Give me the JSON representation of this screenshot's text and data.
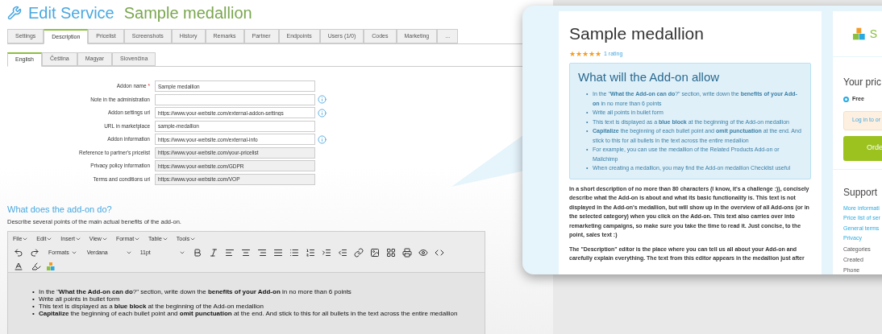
{
  "header": {
    "title": "Edit Service",
    "subtitle": "Sample medallion"
  },
  "tabs": [
    {
      "label": "Settings",
      "selected": false
    },
    {
      "label": "Description",
      "selected": true
    },
    {
      "label": "Pricelist",
      "selected": false
    },
    {
      "label": "Screenshots",
      "selected": false
    },
    {
      "label": "History",
      "selected": false
    },
    {
      "label": "Remarks",
      "selected": false
    },
    {
      "label": "Partner",
      "selected": false
    },
    {
      "label": "Endpoints",
      "selected": false
    },
    {
      "label": "Users (1/0)",
      "selected": false
    },
    {
      "label": "Codes",
      "selected": false
    },
    {
      "label": "Marketing",
      "selected": false
    },
    {
      "label": "...",
      "selected": false
    }
  ],
  "language_tabs": [
    {
      "label": "English",
      "selected": true
    },
    {
      "label": "Čeština",
      "selected": false
    },
    {
      "label": "Magyar",
      "selected": false
    },
    {
      "label": "Slovenčina",
      "selected": false
    }
  ],
  "form": [
    {
      "label": "Addon name",
      "required": true,
      "value": "Sample medallion",
      "info": false,
      "disabled": false
    },
    {
      "label": "Note in the administration",
      "required": false,
      "info": true,
      "disabled": false
    },
    {
      "label": "Addon settings url",
      "required": false,
      "value": "https://www.your-website.com/external-addon-settings",
      "info": true,
      "disabled": false
    },
    {
      "label": "URL in marketplace",
      "required": false,
      "value": "sample-medallion",
      "info": false,
      "disabled": false
    },
    {
      "label": "Addon information",
      "required": false,
      "value": "https://www.your-website.com/external-info",
      "info": true,
      "disabled": false
    },
    {
      "label": "Reference to partner's pricelist",
      "required": false,
      "value": "https://www.your-website.com/your-pricelist",
      "info": false,
      "disabled": true
    },
    {
      "label": "Privacy policy information",
      "required": false,
      "value": "https://www.your-website.com/GDPR",
      "info": false,
      "disabled": true
    },
    {
      "label": "Terms and conditions url",
      "required": false,
      "value": "https://www.your-website.com/VOP",
      "info": false,
      "disabled": true
    }
  ],
  "required_mark": "*",
  "bullet_marker": "•",
  "section": {
    "title": "What does the add-on do?",
    "description": "Describe several points of the main actual benefits of the add-on."
  },
  "editor": {
    "menus": [
      "File",
      "Edit",
      "Insert",
      "View",
      "Format",
      "Table",
      "Tools"
    ],
    "formats": "Formats",
    "font": "Verdana",
    "size": "11pt",
    "bullets": [
      "In the \"**What the Add-on can do**?\" section, write down the **benefits of your Add-on** in no more than 6 points",
      "Write all points in bullet form",
      "This text is displayed as a **blue block** at the beginning of the Add-on medallion",
      "**Capitalize** the beginning of each bullet point and **omit punctuation** at the end. And stick to this for all bullets in the text across the entire medallion"
    ]
  },
  "preview": {
    "title": "Sample medallion",
    "stars": 5,
    "rating": "1 rating",
    "box_title": "What will the Add-on allow",
    "box_bullets": [
      "In the \"**What the Add-on can do**?\" section, write down the **benefits of your Add-on** in no more than 6 points",
      "Write all points in bullet form",
      "This text is displayed as a **blue block** at the beginning of the Add-on medallion",
      "**Capitalize** the beginning of each bullet point and **omit punctuation** at the end. And stick to this for all bullets in the text across the entire medallion",
      "For example, you can use the medallion of the Related Products Add-on or Mailchimp",
      "When creating a medallion, you may find the Add-on medallion Checklist useful"
    ],
    "paragraphs": [
      "In a short description of no more than 80 characters (I know, it's a challenge :)), concisely describe what the Add-on is about and what its basic functionality is. This text is not displayed in the Add-on's medallion, but will show up in the overview of all Add-ons (or in the selected category) when you click on the Add-on. This text also carries over into remarketing campaigns, so make sure you take the time to read it. Just concise, to the point, sales text :)",
      "The \"Description\" editor is the place where you can tell us all about your Add-on and carefully explain everything. The text from this editor appears in the medallion just after"
    ]
  },
  "sidebar": {
    "logo_text": "S",
    "price_title": "Your pric",
    "price_options": [
      {
        "label": "Free",
        "selected": true
      }
    ],
    "login": "Log in to or",
    "order": "Orde",
    "support_title": "Support",
    "links": [
      "More informati",
      "Price list of ser",
      "General terms",
      "Privacy"
    ],
    "details": [
      "Categories",
      "Created",
      "Phone"
    ]
  }
}
